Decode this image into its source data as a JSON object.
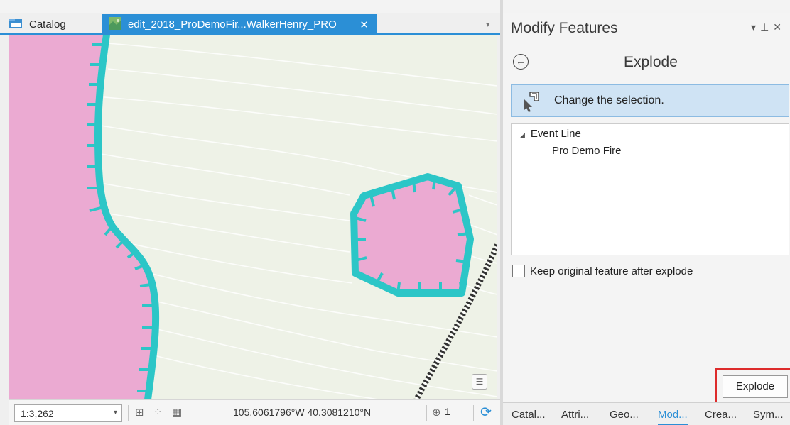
{
  "tabs": {
    "catalog_label": "Catalog",
    "map_label": "edit_2018_ProDemoFir...WalkerHenry_PRO",
    "close_glyph": "✕",
    "overflow_glyph": "▾"
  },
  "map": {
    "layer_colors": {
      "fire_fill": "#ebaad2",
      "perimeter_stroke": "#2cc6c7",
      "background": "#eef2e7",
      "contour": "#ffffff",
      "rail": "#333333"
    }
  },
  "statusbar": {
    "scale": "1:3,262",
    "coordinates": "105.6061796°W 40.3081210°N",
    "selected_count": "1"
  },
  "pane": {
    "title": "Modify Features",
    "tool_name": "Explode",
    "change_selection": "Change the selection.",
    "tree": {
      "layer": "Event Line",
      "feature": "Pro Demo Fire"
    },
    "keep_original_label": "Keep original feature after explode",
    "explode_button": "Explode"
  },
  "bottom_tabs": [
    "Catal...",
    "Attri...",
    "Geo...",
    "Mod...",
    "Crea...",
    "Sym..."
  ],
  "active_bottom_tab": "Mod..."
}
